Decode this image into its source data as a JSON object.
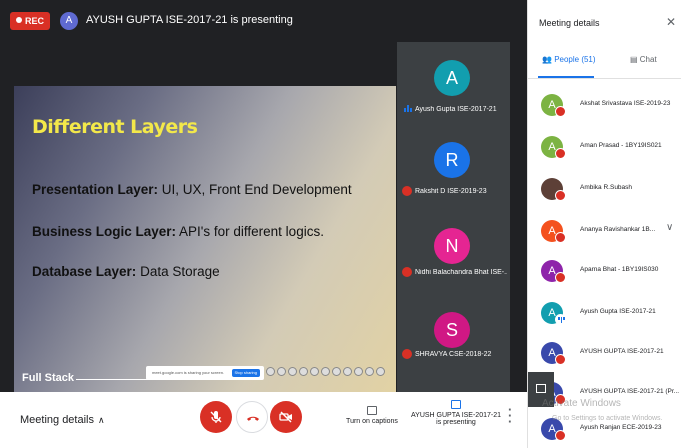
{
  "topbar": {
    "rec_label": "REC",
    "presenter_initial": "A",
    "presenting_text": "AYUSH GUPTA ISE-2017-21 is presenting"
  },
  "slide": {
    "title": "Different Layers",
    "lines": [
      {
        "label": "Presentation Layer:",
        "value": " UI, UX, Front End Development"
      },
      {
        "label": "Business Logic Layer:",
        "value": " API's for different logics."
      },
      {
        "label": "Database Layer:",
        "value": " Data Storage"
      }
    ],
    "footer": "Full Stack",
    "share_bar_text": "meet.google.com is sharing your screen.",
    "share_bar_button": "Stop sharing"
  },
  "tiles": [
    {
      "initial": "A",
      "name": "Ayush Gupta ISE-2017-21",
      "color": "#129eaf",
      "speaking": true
    },
    {
      "initial": "R",
      "name": "Rakshit D ISE-2019-23",
      "color": "#1a73e8",
      "speaking": false
    },
    {
      "initial": "N",
      "name": "Nidhi Balachandra Bhat ISE-...",
      "color": "#e52592",
      "speaking": false
    },
    {
      "initial": "S",
      "name": "SHRAVYA CSE-2018-22",
      "color": "#d01884",
      "speaking": false
    }
  ],
  "bottombar": {
    "meeting_details": "Meeting details",
    "captions_label": "Turn on captions",
    "presenting_label_line1": "AYUSH GUPTA ISE-2017-21",
    "presenting_label_line2": "is presenting"
  },
  "panel": {
    "title": "Meeting details",
    "tab_people": "People (51)",
    "tab_chat": "Chat",
    "people": [
      {
        "initial": "A",
        "name": "Akshat Srivastava ISE-2019-23",
        "color": "#7cb342",
        "muted": true
      },
      {
        "initial": "A",
        "name": "Aman Prasad - 1BY19IS021",
        "color": "#7cb342",
        "muted": true
      },
      {
        "initial": "",
        "name": "Ambika R.Subash",
        "color": "#5d4037",
        "muted": true
      },
      {
        "initial": "A",
        "name": "Ananya Ravishankar 1B...",
        "color": "#f4511e",
        "muted": true,
        "expand": "chevron-down"
      },
      {
        "initial": "A",
        "name": "Aparna Bhat - 1BY19IS030",
        "color": "#8e24aa",
        "muted": true
      },
      {
        "initial": "A",
        "name": "Ayush Gupta ISE-2017-21",
        "color": "#129eaf",
        "muted": false
      },
      {
        "initial": "A",
        "name": "AYUSH GUPTA ISE-2017-21",
        "color": "#3949ab",
        "muted": true
      },
      {
        "initial": "A",
        "name": "AYUSH GUPTA ISE-2017-21 (Pr...",
        "color": "#3949ab",
        "muted": true
      },
      {
        "initial": "A",
        "name": "Ayush Ranjan ECE-2019-23",
        "color": "#3949ab",
        "muted": true
      }
    ],
    "watermark_line1": "Activate Windows",
    "watermark_line2": "Go to Settings to activate Windows."
  }
}
